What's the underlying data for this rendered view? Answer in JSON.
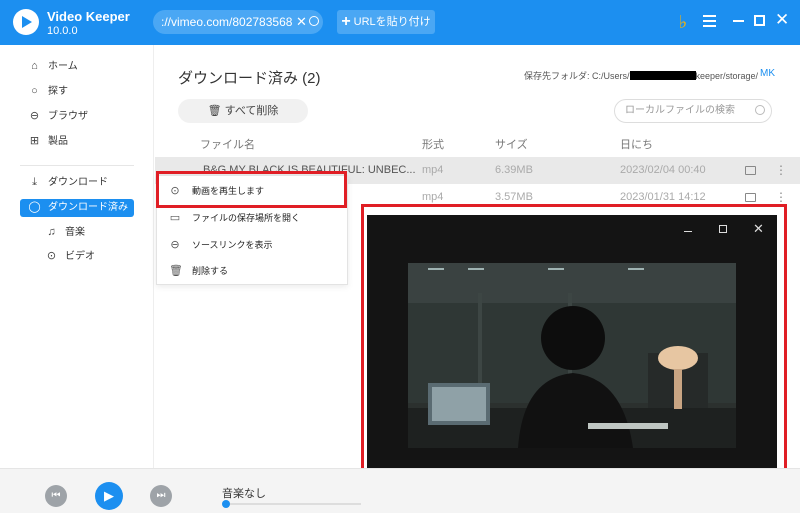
{
  "app": {
    "name": "Video Keeper",
    "version": "10.0.0"
  },
  "url_bar": {
    "value": "://vimeo.com/802783568",
    "paste_label": "URLを貼り付け"
  },
  "sidebar": {
    "items": [
      {
        "label": "ホーム",
        "icon": "home-icon"
      },
      {
        "label": "探す",
        "icon": "search-icon"
      },
      {
        "label": "ブラウザ",
        "icon": "globe-icon"
      },
      {
        "label": "製品",
        "icon": "grid-icon"
      },
      {
        "label": "ダウンロード",
        "icon": "download-icon"
      },
      {
        "label": "ダウンロード済み",
        "icon": "check-circle-icon"
      },
      {
        "label": "音楽",
        "icon": "music-icon"
      },
      {
        "label": "ビデオ",
        "icon": "video-play-icon"
      }
    ],
    "active": "ダウンロード済み"
  },
  "main": {
    "title": "ダウンロード済み (2)",
    "storage_label": "保存先フォルダ: C:/Users/",
    "storage_suffix": "keeper/storage/",
    "mk_label": "MK",
    "delete_all_label": "すべて削除",
    "search_placeholder": "ローカルファイルの検索",
    "columns": [
      "ファイル名",
      "形式",
      "サイズ",
      "日にち"
    ],
    "rows": [
      {
        "name": "B&G MY BLACK IS BEAUTIFUL: UNBEC...",
        "format": "mp4",
        "size": "6.39MB",
        "date": "2023/02/04 00:40"
      },
      {
        "name": "",
        "format": "mp4",
        "size": "3.57MB",
        "date": "2023/01/31 14:12"
      }
    ]
  },
  "context_menu": {
    "items": [
      {
        "label": "動画を再生します",
        "icon": "play-circle-icon"
      },
      {
        "label": "ファイルの保存場所を開く",
        "icon": "folder-icon"
      },
      {
        "label": "ソースリンクを表示",
        "icon": "link-icon"
      },
      {
        "label": "削除する",
        "icon": "trash-icon"
      }
    ]
  },
  "player": {
    "track_label": "音楽なし"
  }
}
